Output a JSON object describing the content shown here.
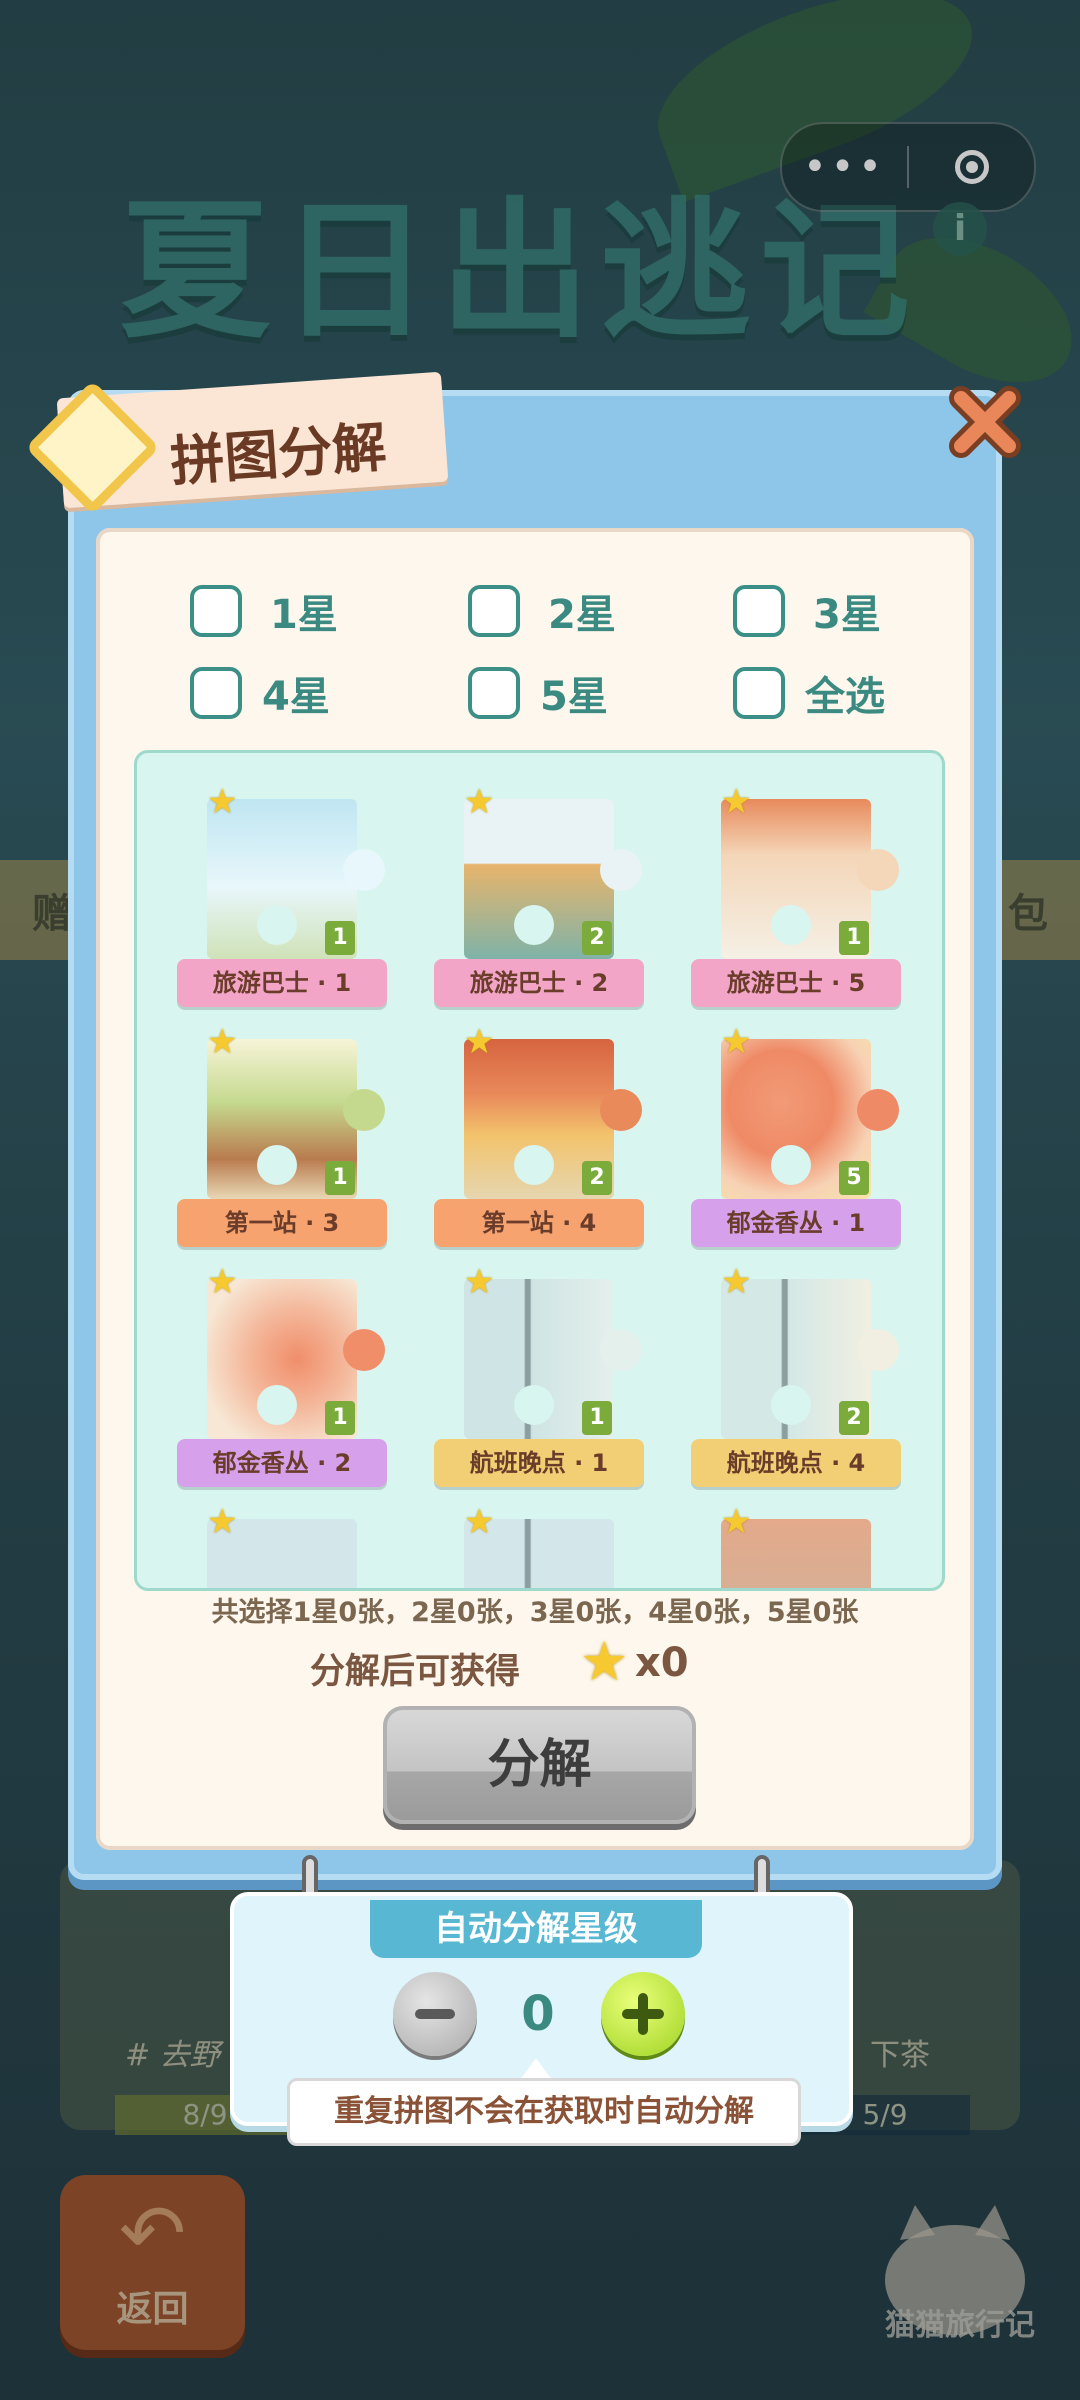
{
  "background": {
    "banner_title": "夏日出逃记",
    "side_left": "赠",
    "side_right": "包",
    "lower_left_label": "# 去野",
    "lower_right_label": "下茶",
    "bar_left": "8/9",
    "bar_right": "5/9",
    "back_label": "返回",
    "logo_label": "猫猫旅行记"
  },
  "dialog": {
    "title": "拼图分解",
    "filters": [
      "1星",
      "2星",
      "3星",
      "4星",
      "5星",
      "全选"
    ],
    "pieces": [
      {
        "name": "旅游巴士 · 1",
        "count": "1",
        "ribbon_color": "#f3a5c8"
      },
      {
        "name": "旅游巴士 · 2",
        "count": "2",
        "ribbon_color": "#f3a5c8"
      },
      {
        "name": "旅游巴士 · 5",
        "count": "1",
        "ribbon_color": "#f3a5c8"
      },
      {
        "name": "第一站 · 3",
        "count": "1",
        "ribbon_color": "#f7a36f"
      },
      {
        "name": "第一站 · 4",
        "count": "2",
        "ribbon_color": "#f7a36f"
      },
      {
        "name": "郁金香丛 · 1",
        "count": "5",
        "ribbon_color": "#d7a0ea"
      },
      {
        "name": "郁金香丛 · 2",
        "count": "1",
        "ribbon_color": "#d7a0ea"
      },
      {
        "name": "航班晚点 · 1",
        "count": "1",
        "ribbon_color": "#f2cf74"
      },
      {
        "name": "航班晚点 · 4",
        "count": "2",
        "ribbon_color": "#f2cf74"
      }
    ],
    "summary": "共选择1星0张，2星0张，3星0张，4星0张，5星0张",
    "reward_label": "分解后可获得",
    "reward_count": "x0",
    "decompose_label": "分解"
  },
  "auto": {
    "title": "自动分解星级",
    "level": "0",
    "tooltip": "重复拼图不会在获取时自动分解"
  },
  "colors": {
    "accent_teal": "#3b8a82",
    "panel_blue": "#8ec6ea",
    "star_yellow": "#f5c92f"
  }
}
